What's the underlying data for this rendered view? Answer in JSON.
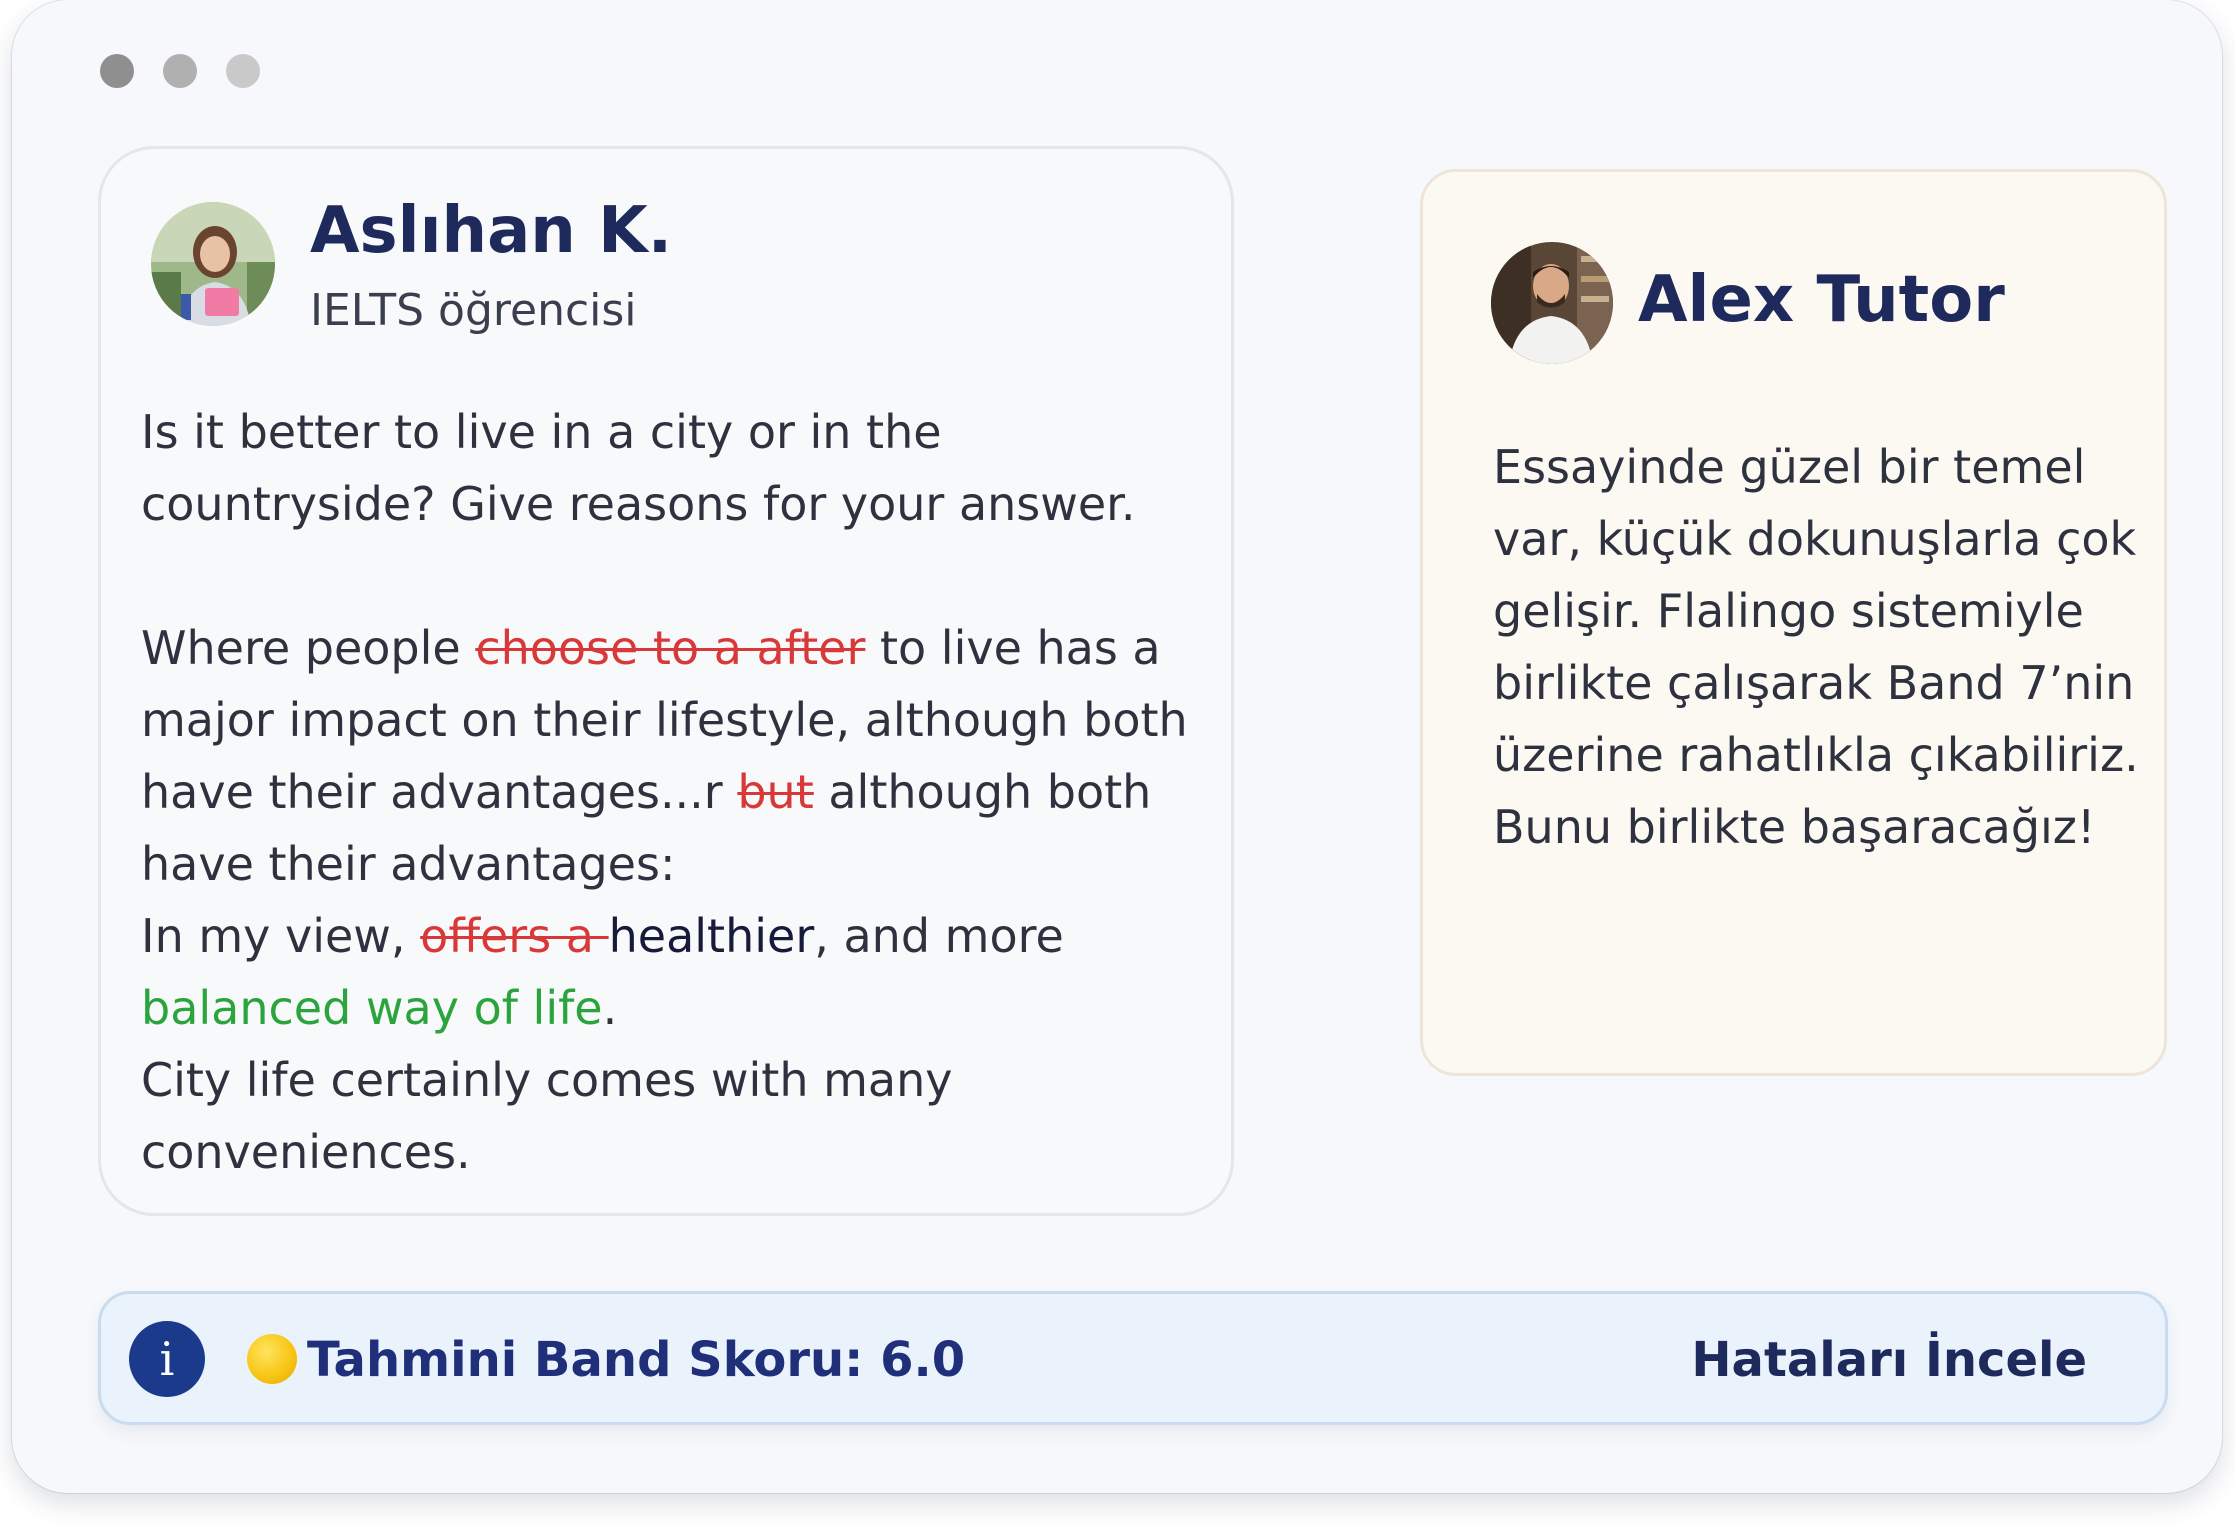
{
  "window": {
    "controls": [
      "close",
      "minimize",
      "maximize"
    ]
  },
  "student": {
    "name": "Aslıhan K.",
    "role": "IELTS öğrencisi",
    "avatar_icon": "student-avatar",
    "essay": {
      "prompt": "Is it better to live in a city or in the countryside? Give reasons for your answer.",
      "line1_a": "Where people ",
      "line1_del": "choose to a after",
      "line1_b": " to live has a major impact on their lifestyle, although both have their advantages...r ",
      "line1_del2": "but",
      "line1_c": " although both have their advantages:",
      "line2_a": "In my view, ",
      "line2_del": "offers a ",
      "line2_ins": "healthier",
      "line2_b": ", and more ",
      "line2_green": "balanced way of life",
      "line2_c": ".",
      "line3": "City life certainly comes with many conveniences."
    }
  },
  "tutor": {
    "name": "Alex Tutor",
    "avatar_icon": "tutor-avatar",
    "message": "Essayinde güzel bir temel var, küçük dokunuşlarla çok gelişir. Flalingo sistemiyle birlikte çalışarak Band 7’nin üzerine rahatlıkla çıkabiliriz. Bunu birlikte başaracağız!"
  },
  "score_bar": {
    "info_icon": "i",
    "coin_icon": "yellow-circle",
    "label": "Tahmini Band Skoru: 6.0",
    "action": "Hataları İncele"
  },
  "colors": {
    "name": "#1f2a5c",
    "deletion": "#d93838",
    "insertion_green": "#2aa43c",
    "info_icon_bg": "#1b3a8c",
    "score_text": "#1f2f7a"
  }
}
